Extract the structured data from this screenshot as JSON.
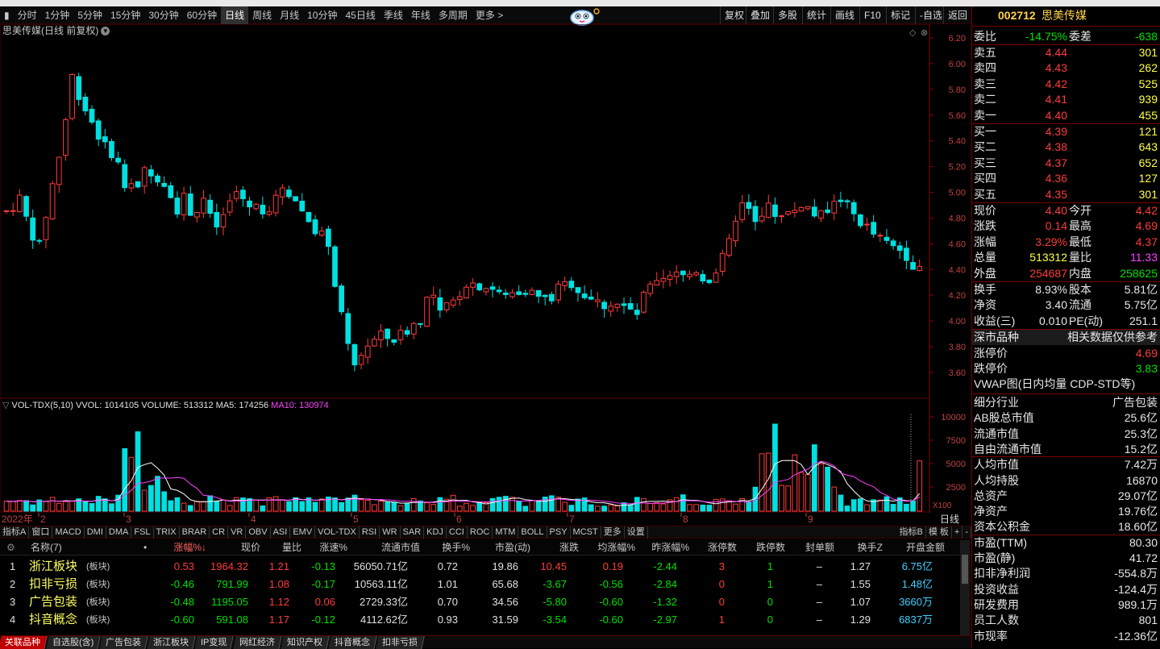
{
  "toolbar": {
    "periods": [
      "分时",
      "1分钟",
      "5分钟",
      "15分钟",
      "30分钟",
      "60分钟",
      "日线",
      "周线",
      "月线",
      "10分钟",
      "45日线",
      "季线",
      "年线",
      "多周期",
      "更多 >"
    ],
    "active": "日线",
    "right_buttons": [
      "复权",
      "叠加",
      "多股",
      "统计",
      "画线",
      "F10",
      "标记",
      "-自选",
      "返回"
    ]
  },
  "chart": {
    "title": "思美传媒(日线 前复权)",
    "y_ticks": [
      "6.20",
      "6.00",
      "5.80",
      "5.60",
      "5.40",
      "5.20",
      "5.00",
      "4.80",
      "4.60",
      "4.40",
      "4.20",
      "4.00",
      "3.80",
      "3.60"
    ]
  },
  "volume": {
    "title_main": "VOL-TDX(5,10)  VVOL: 1014105  VOLUME: 513312  MA5: 174256",
    "title_ma10": "MA10: 130974",
    "y_ticks": [
      "10000",
      "7500",
      "5000",
      "2500"
    ],
    "unit": "X100"
  },
  "date_axis": {
    "labels": [
      "2022年",
      "2",
      "3",
      "4",
      "5",
      "6",
      "7",
      "8",
      "9"
    ],
    "period": "日线"
  },
  "indicators": {
    "left": [
      "指标A",
      "窗口",
      "MACD",
      "DMI",
      "DMA",
      "FSL",
      "TRIX",
      "BRAR",
      "CR",
      "VR",
      "OBV",
      "ASI",
      "EMV",
      "VOL-TDX",
      "RSI",
      "WR",
      "SAR",
      "KDJ",
      "CCI",
      "ROC",
      "MTM",
      "BOLL",
      "PSY",
      "MCST",
      "更多",
      "设置"
    ],
    "right": [
      "指标B",
      "模 板",
      "+",
      "-"
    ]
  },
  "table": {
    "headers": [
      "名称(7)",
      "•",
      "涨幅%↓",
      "现价",
      "量比",
      "涨速%",
      "流通市值",
      "换手%",
      "市盈(动)",
      "涨跌",
      "均涨幅%",
      "昨涨幅%",
      "涨停数",
      "跌停数",
      "封单额",
      "换手Z",
      "开盘金额"
    ],
    "rows": [
      {
        "idx": "1",
        "name": "浙江板块",
        "tag": "(板块)",
        "chg": "0.53",
        "price": "1964.32",
        "vr": "1.21",
        "spd": "-0.13",
        "mcap": "56050.71亿",
        "turn": "0.72",
        "pe": "19.86",
        "diff": "10.45",
        "avg": "0.19",
        "prev": "-2.44",
        "up": "3",
        "down": "1",
        "seal": "–",
        "tz": "1.27",
        "open": "6.75亿"
      },
      {
        "idx": "2",
        "name": "扣非亏损",
        "tag": "(板块)",
        "chg": "-0.46",
        "price": "791.99",
        "vr": "1.08",
        "spd": "-0.17",
        "mcap": "10563.11亿",
        "turn": "1.01",
        "pe": "65.68",
        "diff": "-3.67",
        "avg": "-0.56",
        "prev": "-2.84",
        "up": "0",
        "down": "1",
        "seal": "–",
        "tz": "1.55",
        "open": "1.48亿"
      },
      {
        "idx": "3",
        "name": "广告包装",
        "tag": "(板块)",
        "chg": "-0.48",
        "price": "1195.05",
        "vr": "1.12",
        "spd": "0.06",
        "mcap": "2729.33亿",
        "turn": "0.70",
        "pe": "34.56",
        "diff": "-5.80",
        "avg": "-0.60",
        "prev": "-1.32",
        "up": "0",
        "down": "0",
        "seal": "–",
        "tz": "1.07",
        "open": "3660万"
      },
      {
        "idx": "4",
        "name": "抖音概念",
        "tag": "(板块)",
        "chg": "-0.60",
        "price": "591.08",
        "vr": "1.17",
        "spd": "-0.12",
        "mcap": "4112.62亿",
        "turn": "0.93",
        "pe": "31.59",
        "diff": "-3.54",
        "avg": "-0.60",
        "prev": "-2.97",
        "up": "1",
        "down": "0",
        "seal": "–",
        "tz": "1.29",
        "open": "6837万"
      }
    ]
  },
  "bottom_tabs": [
    "关联品种",
    "自选股(含)",
    "广告包装",
    "浙江板块",
    "IP变现",
    "网红经济",
    "知识产权",
    "抖音概念",
    "扣非亏损"
  ],
  "stock": {
    "code": "002712",
    "name": "思美传媒",
    "wb_label": "委比",
    "wb": "-14.75%",
    "wc_label": "委差",
    "wc": "-638",
    "asks": [
      {
        "l": "卖五",
        "p": "4.44",
        "v": "301"
      },
      {
        "l": "卖四",
        "p": "4.43",
        "v": "262"
      },
      {
        "l": "卖三",
        "p": "4.42",
        "v": "525"
      },
      {
        "l": "卖二",
        "p": "4.41",
        "v": "939"
      },
      {
        "l": "卖一",
        "p": "4.40",
        "v": "455"
      }
    ],
    "bids": [
      {
        "l": "买一",
        "p": "4.39",
        "v": "121"
      },
      {
        "l": "买二",
        "p": "4.38",
        "v": "643"
      },
      {
        "l": "买三",
        "p": "4.37",
        "v": "652"
      },
      {
        "l": "买四",
        "p": "4.36",
        "v": "127"
      },
      {
        "l": "买五",
        "p": "4.35",
        "v": "301"
      }
    ],
    "quote": [
      [
        "现价",
        "4.40",
        "今开",
        "4.42"
      ],
      [
        "涨跌",
        "0.14",
        "最高",
        "4.69"
      ],
      [
        "涨幅",
        "3.29%",
        "最低",
        "4.37"
      ],
      [
        "总量",
        "513312",
        "量比",
        "11.33"
      ],
      [
        "外盘",
        "254687",
        "内盘",
        "258625"
      ]
    ],
    "stats": [
      [
        "换手",
        "8.93%",
        "股本",
        "5.81亿"
      ],
      [
        "净资",
        "3.40",
        "流通",
        "5.75亿"
      ],
      [
        "收益(三)",
        "0.010",
        "PE(动)",
        "251.1"
      ]
    ],
    "market_l": "深市品种",
    "market_r": "相关数据仅供参考",
    "limit_up_l": "涨停价",
    "limit_up": "4.69",
    "limit_dn_l": "跌停价",
    "limit_dn": "3.83",
    "vwap": "VWAP图(日内均量 CDP-STD等)",
    "fund": [
      [
        "细分行业",
        "广告包装"
      ],
      [
        "AB股总市值",
        "25.6亿"
      ],
      [
        "流通市值",
        "25.3亿"
      ],
      [
        "自由流通市值",
        "15.2亿"
      ],
      [
        "人均市值",
        "7.42万"
      ],
      [
        "人均持股",
        "16870"
      ],
      [
        "总资产",
        "29.07亿"
      ],
      [
        "净资产",
        "19.76亿"
      ],
      [
        "资本公积金",
        "18.60亿"
      ],
      [
        "市盈(TTM)",
        "80.30"
      ],
      [
        "市盈(静)",
        "41.72"
      ],
      [
        "扣非净利润",
        "-554.8万"
      ],
      [
        "投资收益",
        "-124.4万"
      ],
      [
        "研发费用",
        "989.1万"
      ],
      [
        "员工人数",
        "801"
      ],
      [
        "市现率",
        "-12.36亿"
      ]
    ]
  },
  "colors": {
    "up": "#ff3b3b",
    "down": "#00e0e0",
    "ma5": "#ffffff",
    "ma10": "#ff40ff",
    "grid": "#3a0000",
    "axis": "#8b0000"
  }
}
